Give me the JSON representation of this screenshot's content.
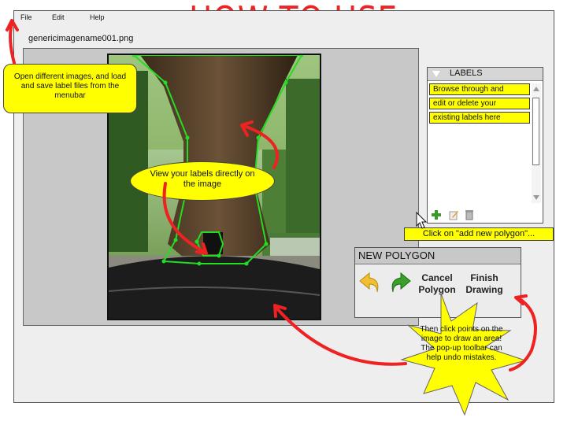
{
  "page": {
    "title": "HOW TO USE"
  },
  "menubar": {
    "file": "File",
    "edit": "Edit",
    "help": "Help"
  },
  "file": {
    "name": "genericimagename001.png"
  },
  "labels_panel": {
    "title": "LABELS",
    "items": [
      "Browse through and",
      "edit or delete your",
      "existing labels here"
    ]
  },
  "notes": {
    "menubar_note": "Open different images, and load and save label files from the menubar",
    "image_note": "View your labels directly on the image",
    "add_polygon_note": "Click on \"add new polygon\"...",
    "star_note": "Then click points on the image to draw an area! The pop-up toolbar can help undo mistakes."
  },
  "new_polygon": {
    "title": "NEW POLYGON",
    "cancel_line1": "Cancel",
    "cancel_line2": "Polygon",
    "finish_line1": "Finish",
    "finish_line2": "Drawing"
  },
  "colors": {
    "accent_red": "#ee2222",
    "note_yellow": "#ffff00",
    "polygon_green": "#22dd22"
  },
  "icons": [
    "add-polygon-icon",
    "edit-label-icon",
    "delete-label-icon",
    "undo-icon",
    "redo-icon"
  ]
}
